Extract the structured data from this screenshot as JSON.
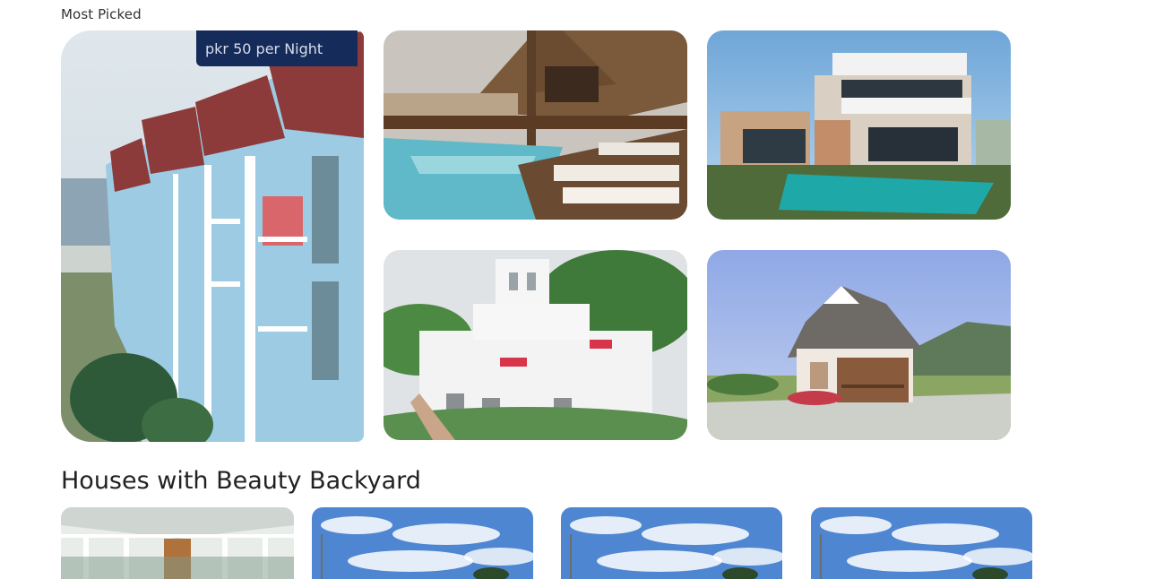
{
  "most_picked": {
    "label": "Most Picked",
    "featured": {
      "price": "pkr 50 per Night",
      "image": "blue-beach-townhouses"
    },
    "items": [
      {
        "image": "resort-pool-deck"
      },
      {
        "image": "modern-villa-pool"
      },
      {
        "image": "white-mediterranean-villa"
      },
      {
        "image": "tudor-cottage-hills"
      }
    ]
  },
  "backyard": {
    "title": "Houses with Beauty Backyard",
    "items": [
      {
        "image": "glass-conservatory"
      },
      {
        "image": "blue-sky-clouds"
      },
      {
        "image": "blue-sky-clouds"
      },
      {
        "image": "blue-sky-clouds"
      }
    ]
  },
  "colors": {
    "price_tag_bg": "#152c5b",
    "price_tag_text": "#d8dde8"
  }
}
